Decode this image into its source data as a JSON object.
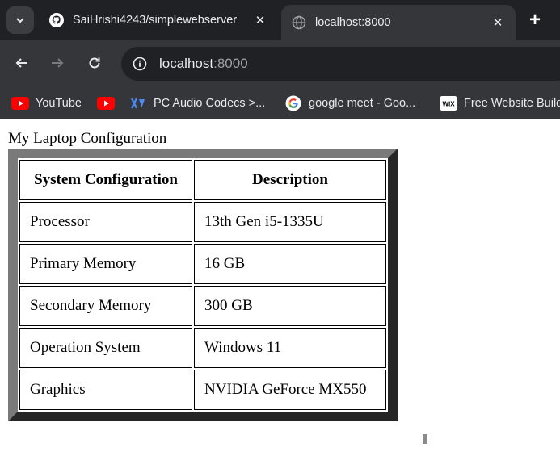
{
  "browser": {
    "tabs": [
      {
        "title": "SaiHrishi4243/simplewebserver",
        "icon": "github-icon",
        "active": false
      },
      {
        "title": "localhost:8000",
        "icon": "globe-icon",
        "active": true
      }
    ],
    "close_glyph": "✕",
    "new_tab_glyph": "+",
    "address": {
      "host": "localhost",
      "port": ":8000"
    },
    "bookmarks": [
      {
        "label": "YouTube",
        "icon": "youtube-icon"
      },
      {
        "label": "",
        "icon": "youtube-icon"
      },
      {
        "label": "PC Audio Codecs >...",
        "icon": "codec-icon"
      },
      {
        "label": "google meet - Goo...",
        "icon": "google-icon"
      },
      {
        "label": "Free Website Builder",
        "icon": "wix-icon"
      }
    ]
  },
  "page": {
    "heading": "My Laptop Configuration",
    "table": {
      "headers": [
        "System Configuration",
        "Description"
      ],
      "rows": [
        [
          "Processor",
          "13th Gen i5-1335U"
        ],
        [
          "Primary Memory",
          "16 GB"
        ],
        [
          "Secondary Memory",
          "300 GB"
        ],
        [
          "Operation System",
          "Windows 11"
        ],
        [
          "Graphics",
          "NVIDIA GeForce MX550"
        ]
      ]
    }
  },
  "colors": {
    "chrome_dark": "#202124",
    "chrome_toolbar": "#35363a",
    "youtube_red": "#ff0000",
    "border_light": "#7a7a7a",
    "border_dark": "#262626"
  }
}
